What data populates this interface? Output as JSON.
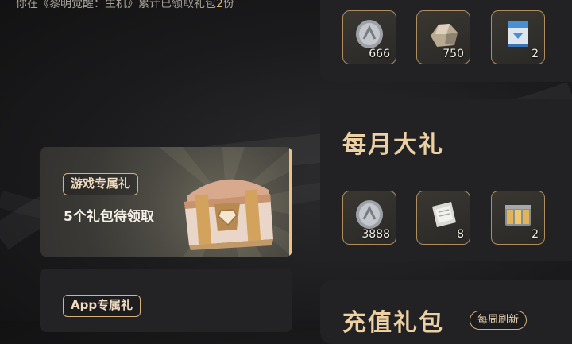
{
  "notice": {
    "prefix": "你在《黎明觉醒：生机》累计已领取礼包",
    "count": "2",
    "suffix": "份"
  },
  "tabs": [
    {
      "label": "游戏专属礼",
      "subtitle": "5个礼包待领取",
      "active": true
    },
    {
      "label": "App专属礼"
    }
  ],
  "top_panel": {
    "items": [
      {
        "icon": "silver-coin-icon",
        "qty": "666"
      },
      {
        "icon": "metal-ore-icon",
        "qty": "750"
      },
      {
        "icon": "supply-pack-icon",
        "qty": "2"
      }
    ]
  },
  "monthly": {
    "title": "每月大礼",
    "items": [
      {
        "icon": "silver-coin-icon",
        "qty": "3888"
      },
      {
        "icon": "paper-ticket-icon",
        "qty": "8"
      },
      {
        "icon": "gold-bars-icon",
        "qty": "2"
      }
    ]
  },
  "recharge": {
    "title": "充值礼包",
    "badge": "每周刷新"
  },
  "colors": {
    "accent": "#e8c187",
    "panel": "#222224",
    "item_border": "#b08d5d"
  }
}
